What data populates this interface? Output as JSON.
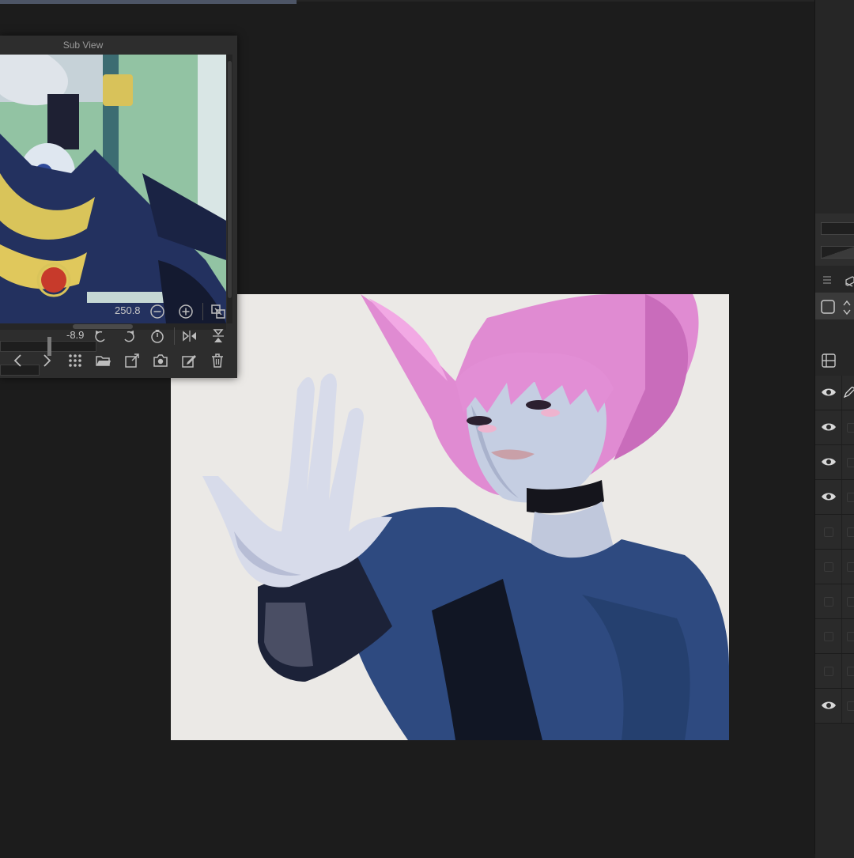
{
  "subview": {
    "title": "Sub View",
    "zoom_value": "250.8",
    "rotation_value": "-8.9"
  },
  "toolbar_icons": [
    "zoom-out-icon",
    "zoom-in-icon",
    "fit-window-icon",
    "rotate-left-icon",
    "rotate-right-icon",
    "reset-rotation-icon",
    "flip-horizontal-icon",
    "flip-vertical-icon",
    "previous-icon",
    "next-icon",
    "grid-icon",
    "open-folder-icon",
    "import-icon",
    "camera-icon",
    "edit-icon",
    "trash-icon"
  ],
  "layers": {
    "visibility": [
      true,
      true,
      true,
      true,
      false,
      false,
      false,
      false,
      false,
      true
    ]
  },
  "colors": {
    "app_bg": "#1c1c1c",
    "panel_bg": "#2d2d2d",
    "canvas_bg": "#ebe9e6",
    "hair_pink": "#e38ad3",
    "shirt_blue": "#2e4c84"
  }
}
